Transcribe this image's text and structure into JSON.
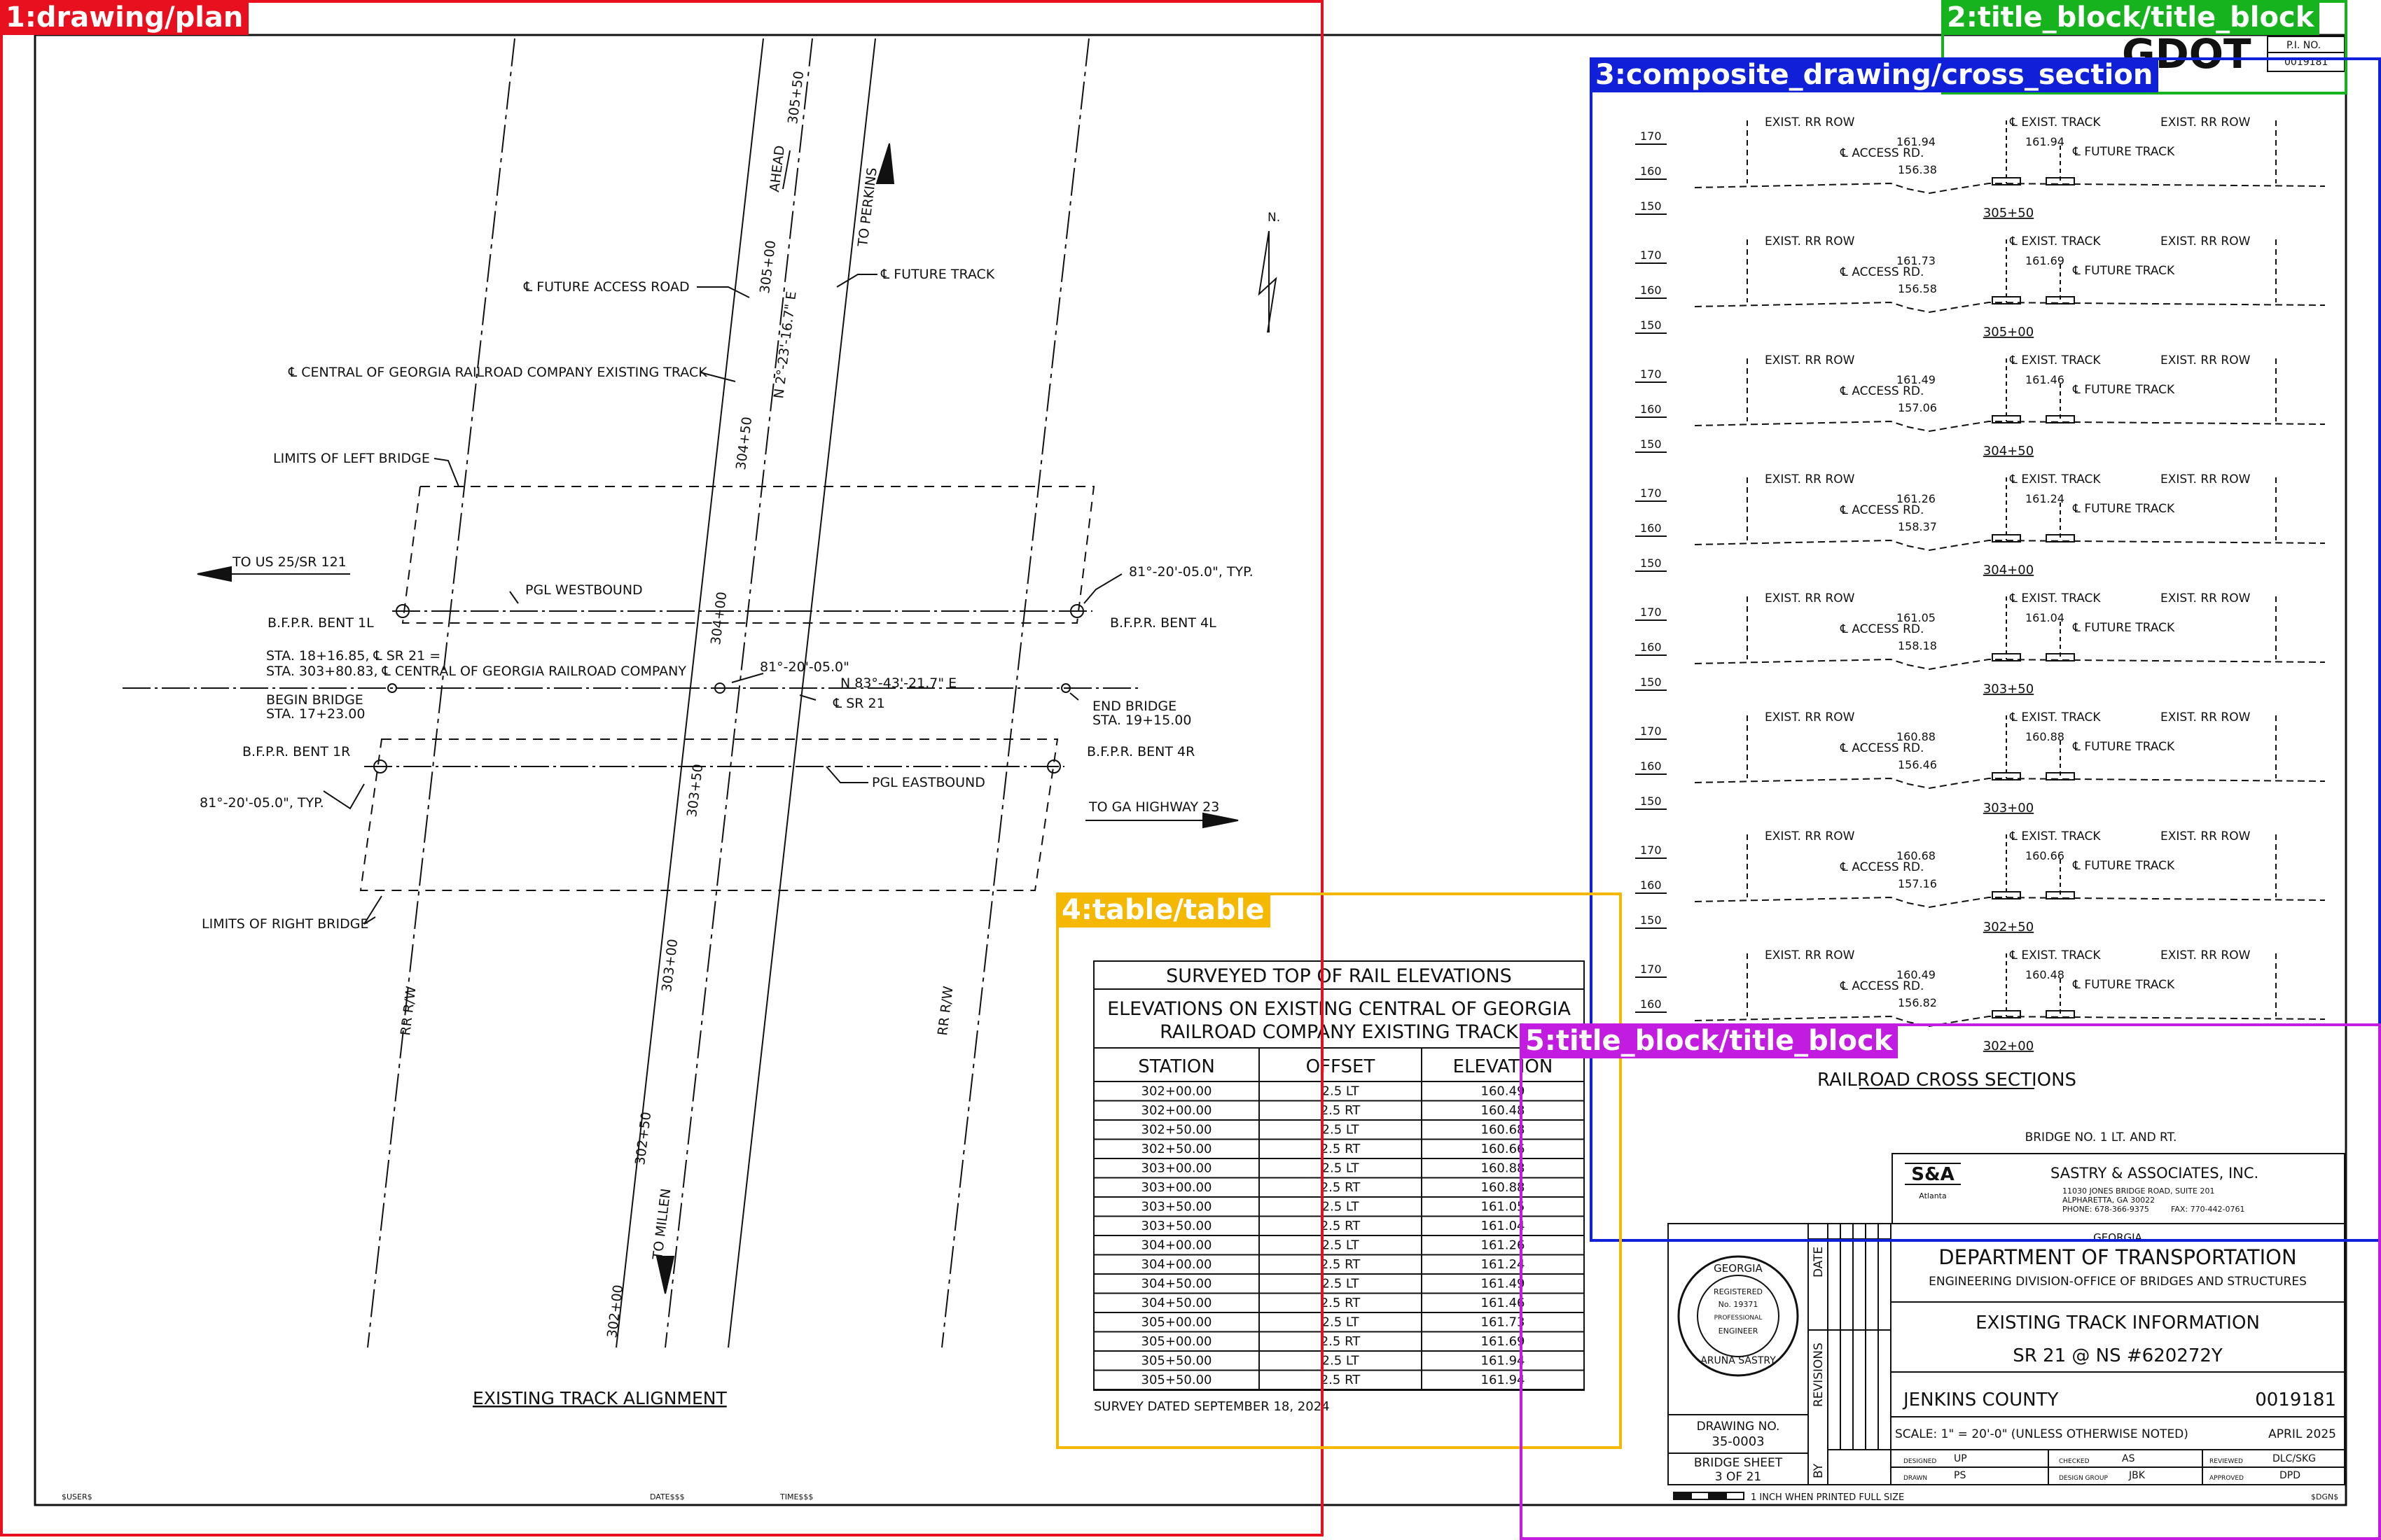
{
  "annotations": [
    {
      "label": "1:drawing/plan",
      "color": "#e8101e"
    },
    {
      "label": "2:title_block/title_block",
      "color": "#16b31e"
    },
    {
      "label": "3:composite_drawing/cross_section",
      "color": "#1020d8"
    },
    {
      "label": "4:table/table",
      "color": "#f5b800"
    },
    {
      "label": "5:title_block/title_block",
      "color": "#c11ce0"
    }
  ],
  "title_corner": {
    "logo": "GDOT",
    "pi_label": "P.I. NO.",
    "pi_number": "0019181"
  },
  "plan": {
    "title": "EXISTING TRACK ALIGNMENT",
    "north": "N.",
    "labels": {
      "future_access_road": "℄ FUTURE ACCESS ROAD",
      "future_track": "℄ FUTURE TRACK",
      "central_georgia": "℄ CENTRAL OF GEORGIA RAILROAD COMPANY EXISTING TRACK",
      "limits_left": "LIMITS OF LEFT BRIDGE",
      "limits_right": "LIMITS OF RIGHT BRIDGE",
      "to_us25": "TO US 25/SR 121",
      "pgl_westbound": "PGL WESTBOUND",
      "pgl_eastbound": "PGL EASTBOUND",
      "bent_1l": "B.F.P.R. BENT 1L",
      "bent_4l": "B.F.P.R. BENT 4L",
      "bent_1r": "B.F.P.R. BENT 1R",
      "bent_4r": "B.F.P.R. BENT 4R",
      "sta_line1": "STA. 18+16.85, ℄ SR 21 =",
      "sta_line2": "STA. 303+80.83, ℄ CENTRAL OF GEORGIA RAILROAD COMPANY",
      "begin_bridge1": "BEGIN BRIDGE",
      "begin_bridge2": "STA. 17+23.00",
      "end_bridge1": "END BRIDGE",
      "end_bridge2": "STA. 19+15.00",
      "angle_center": "81°-20'-05.0\"",
      "angle_typ_top": "81°-20'-05.0\", TYP.",
      "angle_typ_bottom": "81°-20'-05.0\", TYP.",
      "bearing_track": "N 2°-23'-16.7\" E",
      "bearing_sr21": "N 83°-43'-21.7\" E",
      "sr21": "℄ SR 21",
      "to_ga23": "TO GA HIGHWAY 23",
      "to_perkins": "TO PERKINS",
      "to_millen": "TO MILLEN",
      "ahead": "AHEAD",
      "rr_rw": "RR R/W",
      "st_305_50": "305+50",
      "st_305_00": "305+00",
      "st_304_50": "304+50",
      "st_304_00": "304+00",
      "st_303_50": "303+50",
      "st_303_00": "303+00",
      "st_302_50": "302+50",
      "st_302_00": "302+00"
    }
  },
  "table": {
    "title": "SURVEYED TOP OF RAIL ELEVATIONS",
    "subtitle1": "ELEVATIONS ON EXISTING CENTRAL OF GEORGIA",
    "subtitle2": "RAILROAD COMPANY EXISTING TRACK",
    "headers": [
      "STATION",
      "OFFSET",
      "ELEVATION"
    ],
    "rows": [
      [
        "302+00.00",
        "2.5 LT",
        "160.49"
      ],
      [
        "302+00.00",
        "2.5 RT",
        "160.48"
      ],
      [
        "302+50.00",
        "2.5 LT",
        "160.68"
      ],
      [
        "302+50.00",
        "2.5 RT",
        "160.66"
      ],
      [
        "303+00.00",
        "2.5 LT",
        "160.88"
      ],
      [
        "303+00.00",
        "2.5 RT",
        "160.88"
      ],
      [
        "303+50.00",
        "2.5 LT",
        "161.05"
      ],
      [
        "303+50.00",
        "2.5 RT",
        "161.04"
      ],
      [
        "304+00.00",
        "2.5 LT",
        "161.26"
      ],
      [
        "304+00.00",
        "2.5 RT",
        "161.24"
      ],
      [
        "304+50.00",
        "2.5 LT",
        "161.49"
      ],
      [
        "304+50.00",
        "2.5 RT",
        "161.46"
      ],
      [
        "305+00.00",
        "2.5 LT",
        "161.73"
      ],
      [
        "305+00.00",
        "2.5 RT",
        "161.69"
      ],
      [
        "305+50.00",
        "2.5 LT",
        "161.94"
      ],
      [
        "305+50.00",
        "2.5 RT",
        "161.94"
      ]
    ],
    "survey_date": "SURVEY DATED SEPTEMBER 18, 2024"
  },
  "sections": {
    "labels": {
      "exist_rr_row": "EXIST. RR ROW",
      "exist_track": "℄ EXIST. TRACK",
      "access_rd": "℄ ACCESS RD.",
      "future_track": "℄ FUTURE TRACK"
    },
    "scale": [
      "170",
      "160",
      "150"
    ],
    "items": [
      {
        "station": "305+50",
        "access_elev": "156.38",
        "lt": "161.94",
        "rt": "161.94"
      },
      {
        "station": "305+00",
        "access_elev": "156.58",
        "lt": "161.73",
        "rt": "161.69"
      },
      {
        "station": "304+50",
        "access_elev": "157.06",
        "lt": "161.49",
        "rt": "161.46"
      },
      {
        "station": "304+00",
        "access_elev": "158.37",
        "lt": "161.26",
        "rt": "161.24"
      },
      {
        "station": "303+50",
        "access_elev": "158.18",
        "lt": "161.05",
        "rt": "161.04"
      },
      {
        "station": "303+00",
        "access_elev": "156.46",
        "lt": "160.88",
        "rt": "160.88"
      },
      {
        "station": "302+50",
        "access_elev": "157.16",
        "lt": "160.68",
        "rt": "160.66"
      },
      {
        "station": "302+00",
        "access_elev": "156.82",
        "lt": "160.49",
        "rt": "160.48"
      }
    ]
  },
  "title_block": {
    "sheet_title": "RAILROAD CROSS SECTIONS",
    "bridge_no": "BRIDGE NO. 1 LT. AND RT.",
    "firm_logo": "S&A",
    "firm_logo_sub": "Atlanta",
    "firm_name": "SASTRY & ASSOCIATES, INC.",
    "firm_addr1": "11030 JONES BRIDGE ROAD, SUITE 201",
    "firm_addr2": "ALPHARETTA, GA 30022",
    "firm_phone": "PHONE: 678-366-9375",
    "firm_fax": "FAX: 770-442-0761",
    "state": "GEORGIA",
    "dept": "DEPARTMENT OF TRANSPORTATION",
    "division": "ENGINEERING DIVISION-OFFICE OF BRIDGES AND STRUCTURES",
    "title1": "EXISTING TRACK INFORMATION",
    "title2": "SR 21 @ NS #620272Y",
    "county": "JENKINS COUNTY",
    "pi_no": "0019181",
    "scale_note": "SCALE: 1\" = 20'-0\" (UNLESS OTHERWISE NOTED)",
    "date": "APRIL 2025",
    "drawing_no_label": "DRAWING NO.",
    "drawing_no": "35-0003",
    "bridge_sheet_label": "BRIDGE SHEET",
    "bridge_sheet": "3 OF 21",
    "date_col": "DATE",
    "revisions_col": "REVISIONS",
    "by_col": "BY",
    "designed_label": "DESIGNED",
    "designed": "UP",
    "checked_label": "CHECKED",
    "checked": "AS",
    "reviewed_label": "REVIEWED",
    "reviewed": "DLC/SKG",
    "drawn_label": "DRAWN",
    "drawn": "PS",
    "design_group_label": "DESIGN GROUP",
    "design_group": "JBK",
    "approved_label": "APPROVED",
    "approved": "DPD",
    "seal_line1": "GEORGIA",
    "seal_line2": "REGISTERED",
    "seal_no": "No. 19371",
    "seal_prof": "PROFESSIONAL",
    "seal_eng": "ENGINEER",
    "seal_name": "ARUNA SASTRY",
    "print_note": "1 INCH WHEN PRINTED FULL SIZE"
  },
  "footer": {
    "user": "$USER$",
    "date": "DATE$$$",
    "time": "TIME$$$",
    "file": "$DGN$"
  }
}
